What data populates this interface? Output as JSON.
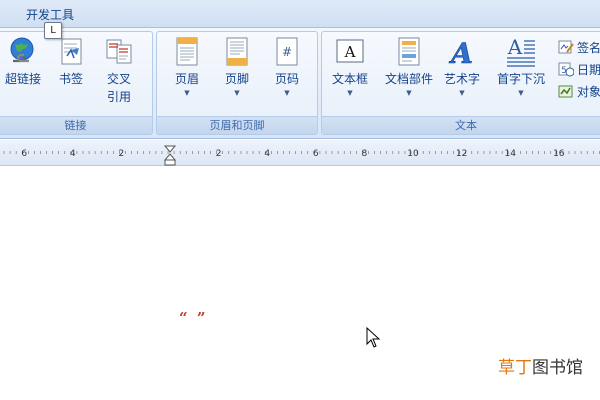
{
  "tab": {
    "label": "开发工具",
    "keytip": "L"
  },
  "groups": [
    {
      "caption": "链接",
      "buttons": [
        {
          "label": "超链接",
          "icon": "hyperlink-globe-icon"
        },
        {
          "label": "书签",
          "icon": "bookmark-icon"
        },
        {
          "label": "交叉\n引用",
          "icon": "cross-reference-icon"
        }
      ]
    },
    {
      "caption": "页眉和页脚",
      "buttons": [
        {
          "label": "页眉",
          "icon": "header-icon"
        },
        {
          "label": "页脚",
          "icon": "footer-icon"
        },
        {
          "label": "页码",
          "icon": "page-number-icon",
          "glyph": "#"
        }
      ]
    },
    {
      "caption": "文本",
      "buttons": [
        {
          "label": "文本框",
          "icon": "textbox-icon",
          "glyph": "A"
        },
        {
          "label": "文档部件",
          "icon": "quick-parts-icon"
        },
        {
          "label": "艺术字",
          "icon": "wordart-icon",
          "glyph": "A"
        },
        {
          "label": "首字下沉",
          "icon": "drop-cap-icon",
          "glyph": "A"
        }
      ],
      "small_items": [
        {
          "label": "签名",
          "visible_text": "签名",
          "icon": "signature-line-icon"
        },
        {
          "label": "日期",
          "visible_text": "日期",
          "icon": "date-time-icon"
        },
        {
          "label": "对象",
          "visible_text": "对象",
          "icon": "object-icon"
        }
      ]
    }
  ],
  "ruler": {
    "left_labels": [
      "6",
      "4",
      "2"
    ],
    "right_labels": [
      "2",
      "4",
      "6",
      "8",
      "10",
      "12",
      "14",
      "16"
    ]
  },
  "document": {
    "quotes": "“ ”"
  },
  "watermark": {
    "part1": "草丁",
    "part2": "图书馆"
  },
  "colors": {
    "ribbon_text": "#15428b",
    "caption_text": "#3e6aaa",
    "quote_red": "#c0392b",
    "watermark_orange": "#e07a10"
  }
}
